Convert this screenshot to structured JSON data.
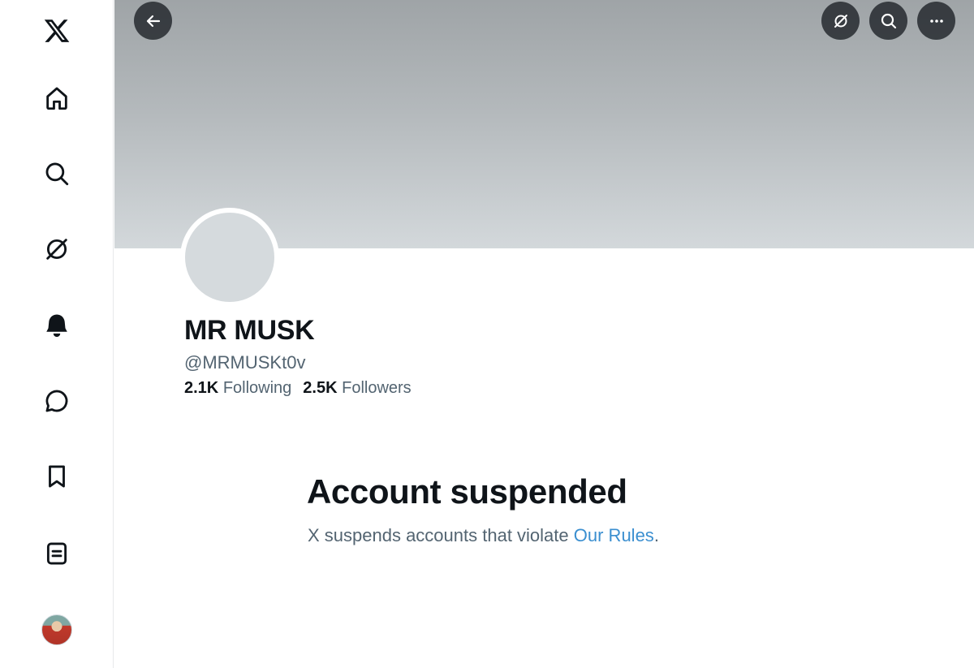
{
  "sidebar": {
    "items": [
      {
        "name": "x-logo",
        "label": "X"
      },
      {
        "name": "home",
        "label": "Home"
      },
      {
        "name": "explore",
        "label": "Explore"
      },
      {
        "name": "grok",
        "label": "Grok"
      },
      {
        "name": "notifications",
        "label": "Notifications"
      },
      {
        "name": "messages",
        "label": "Messages"
      },
      {
        "name": "bookmarks",
        "label": "Bookmarks"
      },
      {
        "name": "lists",
        "label": "Lists"
      },
      {
        "name": "profile",
        "label": "Profile"
      }
    ]
  },
  "header": {
    "icons": [
      "back-arrow-icon",
      "grok-icon",
      "search-icon",
      "more-icon"
    ]
  },
  "profile": {
    "display_name": "MR MUSK",
    "handle": "@MRMUSKt0v",
    "following_count": "2.1K",
    "following_label": "Following",
    "followers_count": "2.5K",
    "followers_label": "Followers"
  },
  "suspension": {
    "title": "Account suspended",
    "message_prefix": "X suspends accounts that violate ",
    "link_label": "Our Rules",
    "message_suffix": "."
  },
  "colors": {
    "text_primary": "#0f1419",
    "text_secondary": "#536471",
    "link": "#3b8fd0",
    "banner_top": "#9fa4a7",
    "banner_bottom": "#d3d8db"
  }
}
